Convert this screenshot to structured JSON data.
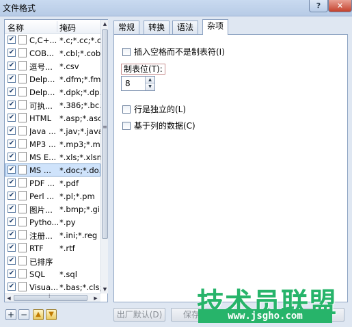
{
  "window": {
    "title": "文件格式",
    "help_label": "?",
    "close_label": "✕"
  },
  "list": {
    "headers": {
      "name": "名称",
      "mask": "掩码"
    },
    "rows": [
      {
        "name": "C,C+...",
        "mask": "*.c;*.cc;*.c...",
        "checked": true
      },
      {
        "name": "COB...",
        "mask": "*.cbl;*.cob...",
        "checked": true
      },
      {
        "name": "逗号...",
        "mask": "*.csv",
        "checked": true
      },
      {
        "name": "Delp...",
        "mask": "*.dfm;*.fm...",
        "checked": true
      },
      {
        "name": "Delp...",
        "mask": "*.dpk;*.dp...",
        "checked": true
      },
      {
        "name": "可执...",
        "mask": "*.386;*.bc...",
        "checked": true
      },
      {
        "name": "HTML",
        "mask": "*.asp;*.asc",
        "checked": true
      },
      {
        "name": "Java ...",
        "mask": "*.jav;*.java",
        "checked": true
      },
      {
        "name": "MP3 ...",
        "mask": "*.mp3;*.m...",
        "checked": true
      },
      {
        "name": "MS E...",
        "mask": "*.xls;*.xlsm",
        "checked": true
      },
      {
        "name": "MS ...",
        "mask": "*.doc;*.do...",
        "checked": true
      },
      {
        "name": "PDF ...",
        "mask": "*.pdf",
        "checked": true
      },
      {
        "name": "Perl ...",
        "mask": "*.pl;*.pm",
        "checked": true
      },
      {
        "name": "图片...",
        "mask": "*.bmp;*.gi...",
        "checked": true
      },
      {
        "name": "Pytho...",
        "mask": "*.py",
        "checked": true
      },
      {
        "name": "注册...",
        "mask": "*.ini;*.reg",
        "checked": true
      },
      {
        "name": "RTF",
        "mask": "*.rtf",
        "checked": true
      },
      {
        "name": "已排序",
        "mask": "",
        "checked": true
      },
      {
        "name": "SQL",
        "mask": "*.sql",
        "checked": true
      },
      {
        "name": "Visua...",
        "mask": "*.bas;*.cls;...",
        "checked": true
      }
    ],
    "selected_index": 10
  },
  "left_buttons": {
    "add": "+",
    "remove": "−",
    "up": "▲",
    "down": "▼"
  },
  "tabs": [
    {
      "label": "常规",
      "active": false
    },
    {
      "label": "转换",
      "active": false
    },
    {
      "label": "语法",
      "active": false
    },
    {
      "label": "杂项",
      "active": true
    }
  ],
  "misc": {
    "insert_spaces_label": "插入空格而不是制表符(I)",
    "tab_stop_label": "制表位(T):",
    "tab_stop_value": "8",
    "standalone_rows_label": "行是独立的(L)",
    "column_data_label": "基于列的数据(C)"
  },
  "bottom_buttons": {
    "factory_defaults": "出厂默认(D)",
    "save": "保存",
    "cancel": "消"
  },
  "watermark": {
    "title": "技术员联盟",
    "url": "www.jsgho.com"
  }
}
